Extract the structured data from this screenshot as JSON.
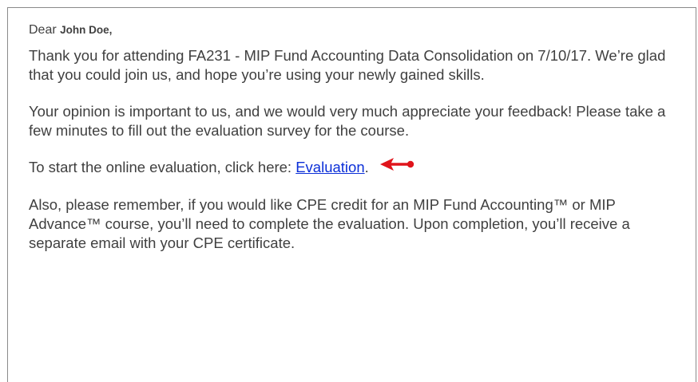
{
  "greeting": {
    "salutation": "Dear",
    "recipient_name": "John Doe",
    "trailing": ","
  },
  "paragraphs": {
    "p1": "Thank you for attending FA231 - MIP Fund Accounting Data Consolidation on 7/10/17. We’re glad that you could join us, and hope you’re using your newly gained skills.",
    "p2": "Your opinion is important to us, and we would very much appreciate your feedback! Please take a few minutes to fill out the evaluation survey for the course.",
    "p3_prefix": "To start the online evaluation, click here: ",
    "p3_link": "Evaluation",
    "p3_suffix": ".",
    "p4": "Also, please remember, if you would like CPE credit for an MIP Fund Accounting™ or MIP Advance™ course, you’ll need to complete the evaluation. Upon completion, you’ll receive a separate email with your CPE certificate."
  },
  "annotation": {
    "arrow_icon": "red-pointer-arrow-icon",
    "arrow_color": "#e0141b"
  },
  "colors": {
    "text": "#404040",
    "link": "#0b2fd8",
    "border": "#8a8a8a"
  }
}
